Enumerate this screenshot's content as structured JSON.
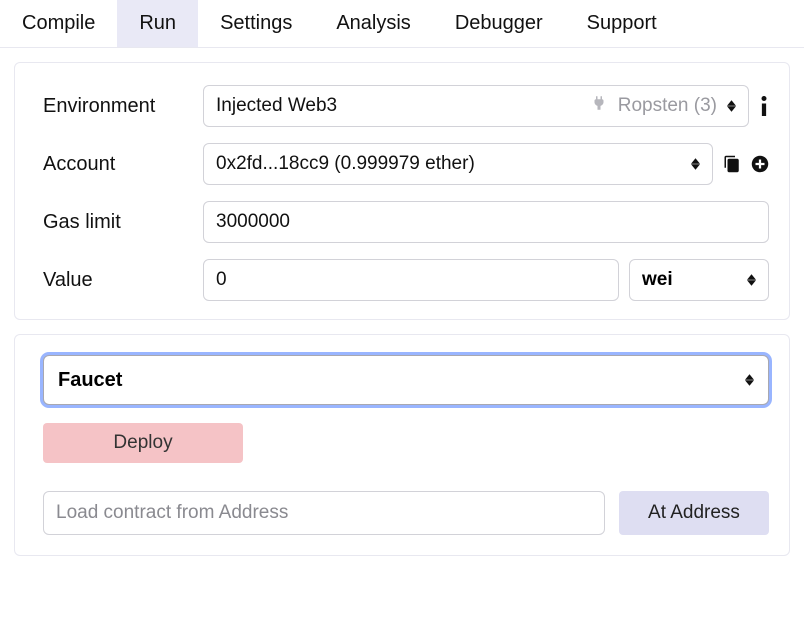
{
  "tabs": {
    "compile": "Compile",
    "run": "Run",
    "settings": "Settings",
    "analysis": "Analysis",
    "debugger": "Debugger",
    "support": "Support"
  },
  "env": {
    "label": "Environment",
    "value": "Injected Web3",
    "network": "Ropsten (3)"
  },
  "account": {
    "label": "Account",
    "value": "0x2fd...18cc9 (0.999979 ether)"
  },
  "gas": {
    "label": "Gas limit",
    "value": "3000000"
  },
  "value": {
    "label": "Value",
    "amount": "0",
    "unit": "wei"
  },
  "contract": {
    "selected": "Faucet",
    "deploy_label": "Deploy",
    "load_placeholder": "Load contract from Address",
    "at_address_label": "At Address"
  }
}
